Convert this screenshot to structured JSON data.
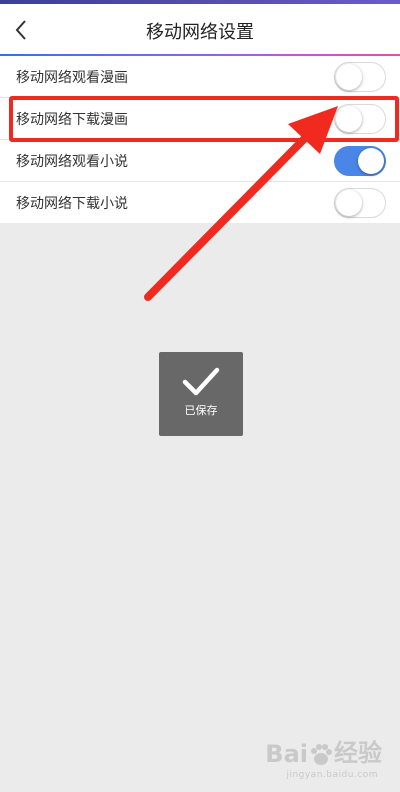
{
  "header": {
    "title": "移动网络设置",
    "accent_gradient": [
      "#3b6cf0",
      "#c05ad0",
      "#e84fa0"
    ]
  },
  "settings": [
    {
      "label": "移动网络观看漫画",
      "enabled": false
    },
    {
      "label": "移动网络下载漫画",
      "enabled": false,
      "highlighted": true
    },
    {
      "label": "移动网络观看小说",
      "enabled": true
    },
    {
      "label": "移动网络下载小说",
      "enabled": false
    }
  ],
  "toast": {
    "text": "已保存",
    "icon": "checkmark-icon"
  },
  "annotation": {
    "color": "#f02a1f"
  },
  "watermark": {
    "brand": "Bai",
    "brand_suffix": "经验",
    "sub": "jingyan.baidu.com"
  },
  "colors": {
    "toggle_on": "#4a86e8",
    "background": "#ebebeb"
  }
}
